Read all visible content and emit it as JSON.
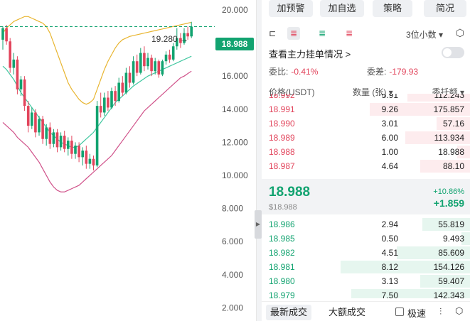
{
  "chart": {
    "y_axis_ticks": [
      "20.000",
      "18.000",
      "16.000",
      "14.000",
      "12.000",
      "10.000",
      "8.000",
      "6.000",
      "4.000",
      "2.000"
    ],
    "y_axis_values": [
      20,
      18,
      16,
      14,
      12,
      10,
      8,
      6,
      4,
      2
    ],
    "current_price_tag": "18.988",
    "high_label": "19.280 →",
    "colors": {
      "up": "#12a370",
      "down": "#e2455c",
      "upper_band": "#e8b530",
      "middle_band": "#40c7a0",
      "lower_band": "#d0528a"
    }
  },
  "chart_data": {
    "type": "candlestick",
    "ylim": [
      1.2,
      20.6
    ],
    "candles": [
      [
        18.2,
        18.9,
        19.0,
        17.6
      ],
      [
        18.9,
        18.1,
        19.1,
        17.9
      ],
      [
        18.1,
        16.5,
        18.3,
        16.2
      ],
      [
        16.5,
        17.0,
        17.4,
        16.1
      ],
      [
        17.0,
        15.2,
        17.2,
        14.9
      ],
      [
        15.2,
        15.8,
        16.0,
        14.8
      ],
      [
        15.8,
        14.2,
        16.0,
        13.9
      ],
      [
        14.2,
        13.0,
        14.5,
        12.6
      ],
      [
        13.0,
        13.8,
        14.1,
        12.8
      ],
      [
        13.8,
        12.6,
        14.0,
        12.3
      ],
      [
        12.6,
        13.4,
        13.6,
        12.4
      ],
      [
        13.4,
        12.2,
        13.6,
        11.9
      ],
      [
        12.2,
        12.9,
        13.1,
        11.8
      ],
      [
        12.9,
        11.9,
        13.2,
        11.6
      ],
      [
        11.9,
        12.6,
        12.8,
        11.7
      ],
      [
        12.6,
        11.7,
        12.8,
        11.4
      ],
      [
        11.7,
        12.4,
        12.6,
        11.5
      ],
      [
        12.4,
        11.6,
        12.7,
        11.4
      ],
      [
        11.6,
        12.1,
        12.3,
        11.2
      ],
      [
        12.1,
        11.3,
        12.4,
        11.0
      ],
      [
        11.3,
        11.8,
        12.0,
        11.0
      ],
      [
        11.8,
        11.1,
        12.0,
        10.8
      ],
      [
        11.1,
        11.5,
        11.7,
        10.6
      ],
      [
        11.5,
        10.7,
        11.8,
        10.4
      ],
      [
        10.7,
        11.0,
        11.3,
        10.4
      ],
      [
        11.0,
        10.6,
        11.2,
        10.3
      ],
      [
        10.6,
        14.2,
        14.5,
        10.5
      ],
      [
        14.2,
        13.8,
        15.0,
        13.5
      ],
      [
        13.8,
        14.7,
        15.0,
        13.6
      ],
      [
        14.7,
        14.1,
        15.1,
        13.9
      ],
      [
        14.1,
        15.1,
        15.3,
        14.0
      ],
      [
        15.1,
        14.5,
        15.4,
        14.2
      ],
      [
        14.5,
        15.6,
        15.9,
        14.4
      ],
      [
        15.6,
        15.0,
        16.0,
        14.8
      ],
      [
        15.0,
        16.2,
        16.5,
        14.9
      ],
      [
        16.2,
        15.6,
        16.6,
        15.3
      ],
      [
        15.6,
        16.9,
        17.2,
        15.5
      ],
      [
        16.9,
        16.2,
        17.3,
        16.0
      ],
      [
        16.2,
        17.4,
        17.7,
        16.1
      ],
      [
        17.4,
        16.6,
        17.8,
        16.3
      ],
      [
        16.6,
        17.1,
        17.4,
        16.4
      ],
      [
        17.1,
        16.3,
        17.3,
        16.0
      ],
      [
        16.3,
        16.9,
        17.1,
        16.1
      ],
      [
        16.9,
        16.1,
        17.0,
        15.9
      ],
      [
        16.1,
        16.9,
        17.0,
        16.0
      ],
      [
        16.9,
        17.3,
        17.5,
        16.7
      ],
      [
        17.3,
        17.0,
        17.6,
        16.8
      ],
      [
        17.0,
        17.8,
        18.0,
        16.9
      ],
      [
        17.8,
        18.3,
        18.9,
        17.6
      ],
      [
        18.3,
        18.0,
        18.6,
        17.7
      ],
      [
        18.0,
        18.6,
        18.9,
        17.9
      ],
      [
        18.6,
        18.4,
        19.0,
        18.2
      ],
      [
        18.4,
        18.99,
        19.28,
        18.3
      ]
    ],
    "upper_band": [
      18.6,
      18.9,
      19.1,
      19.3,
      19.4,
      19.5,
      19.6,
      19.6,
      19.5,
      19.4,
      19.3,
      19.2,
      19.0,
      18.6,
      18.0,
      17.4,
      16.8,
      16.2,
      15.6,
      15.2,
      14.9,
      14.6,
      14.4,
      14.3,
      14.4,
      14.6,
      15.2,
      15.8,
      16.4,
      16.9,
      17.3,
      17.7,
      18.0,
      18.2,
      18.3,
      18.4,
      18.45,
      18.5,
      18.55,
      18.6,
      18.65,
      18.7,
      18.75,
      18.8,
      18.85,
      18.9,
      18.95,
      19.0,
      19.05,
      19.1,
      19.15,
      19.2,
      19.25
    ],
    "middle_band": [
      16.6,
      16.4,
      16.1,
      15.8,
      15.4,
      15.0,
      14.7,
      14.4,
      14.1,
      13.8,
      13.5,
      13.2,
      12.9,
      12.6,
      12.4,
      12.2,
      12.0,
      11.9,
      11.8,
      11.7,
      11.7,
      11.8,
      12.0,
      12.2,
      12.4,
      12.6,
      12.9,
      13.2,
      13.5,
      13.8,
      14.1,
      14.4,
      14.6,
      14.8,
      15.0,
      15.2,
      15.4,
      15.55,
      15.7,
      15.85,
      16.0,
      16.1,
      16.2,
      16.3,
      16.4,
      16.5,
      16.6,
      16.7,
      16.8,
      16.9,
      17.0,
      17.1,
      17.2
    ],
    "lower_band": [
      13.2,
      13.0,
      12.8,
      12.6,
      12.3,
      12.1,
      11.9,
      11.7,
      11.4,
      11.1,
      10.8,
      10.4,
      10.0,
      9.6,
      9.3,
      9.1,
      9.0,
      9.0,
      9.1,
      9.2,
      9.3,
      9.4,
      9.6,
      9.8,
      10.0,
      10.2,
      10.4,
      10.6,
      10.8,
      11.0,
      11.2,
      11.5,
      11.8,
      12.1,
      12.4,
      12.7,
      13.0,
      13.3,
      13.6,
      13.9,
      14.1,
      14.3,
      14.5,
      14.7,
      14.9,
      15.1,
      15.3,
      15.5,
      15.7,
      15.9,
      16.0,
      16.15,
      16.3
    ]
  },
  "top_buttons": [
    "加预警",
    "加自选",
    "策略",
    "简况"
  ],
  "toolbar": {
    "precision": "3位小数 ▾",
    "main_force": "查看主力挂单情况 >"
  },
  "ratios": {
    "bid_ratio_label": "委比:",
    "bid_ratio_value": "-0.41%",
    "diff_label": "委差:",
    "diff_value": "-179.93"
  },
  "headers": {
    "price": "价格(USDT)",
    "qty": "数量 (张) ▾",
    "total": "委托额 ▾"
  },
  "asks": [
    {
      "p": "18.992",
      "q": "5.91",
      "t": "112.243",
      "w": 30
    },
    {
      "p": "18.991",
      "q": "9.26",
      "t": "175.857",
      "w": 48
    },
    {
      "p": "18.990",
      "q": "3.01",
      "t": "57.16",
      "w": 16
    },
    {
      "p": "18.989",
      "q": "6.00",
      "t": "113.934",
      "w": 31
    },
    {
      "p": "18.988",
      "q": "1.00",
      "t": "18.988",
      "w": 6
    },
    {
      "p": "18.987",
      "q": "4.64",
      "t": "88.10",
      "w": 24
    }
  ],
  "mid": {
    "price": "18.988",
    "usd": "$18.988",
    "pct": "+10.86%",
    "change": "+1.859"
  },
  "bids": [
    {
      "p": "18.986",
      "q": "2.94",
      "t": "55.819",
      "w": 23
    },
    {
      "p": "18.985",
      "q": "0.50",
      "t": "9.493",
      "w": 4
    },
    {
      "p": "18.982",
      "q": "4.51",
      "t": "85.609",
      "w": 35
    },
    {
      "p": "18.981",
      "q": "8.12",
      "t": "154.126",
      "w": 62
    },
    {
      "p": "18.980",
      "q": "3.13",
      "t": "59.407",
      "w": 24
    },
    {
      "p": "18.979",
      "q": "7.50",
      "t": "142.343",
      "w": 57
    }
  ],
  "footer": {
    "latest_trades": "最新成交",
    "large_trades": "大额成交",
    "fast": "极速"
  }
}
